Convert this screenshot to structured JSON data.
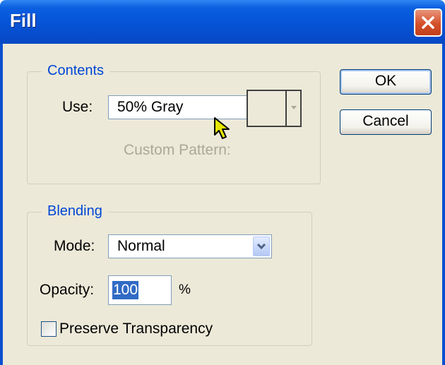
{
  "window": {
    "title": "Fill"
  },
  "contents": {
    "legend": "Contents",
    "use_label": "Use:",
    "use_value": "50% Gray",
    "custom_pattern_label": "Custom Pattern:"
  },
  "blending": {
    "legend": "Blending",
    "mode_label": "Mode:",
    "mode_value": "Normal",
    "opacity_label": "Opacity:",
    "opacity_value": "100",
    "opacity_unit": "%",
    "preserve_label": "Preserve Transparency",
    "preserve_checked": false
  },
  "buttons": {
    "ok": "OK",
    "cancel": "Cancel"
  },
  "colors": {
    "accent": "#0046d5",
    "titlebar": "#0653d6",
    "face": "#ece9d8",
    "selection": "#316ac5"
  }
}
